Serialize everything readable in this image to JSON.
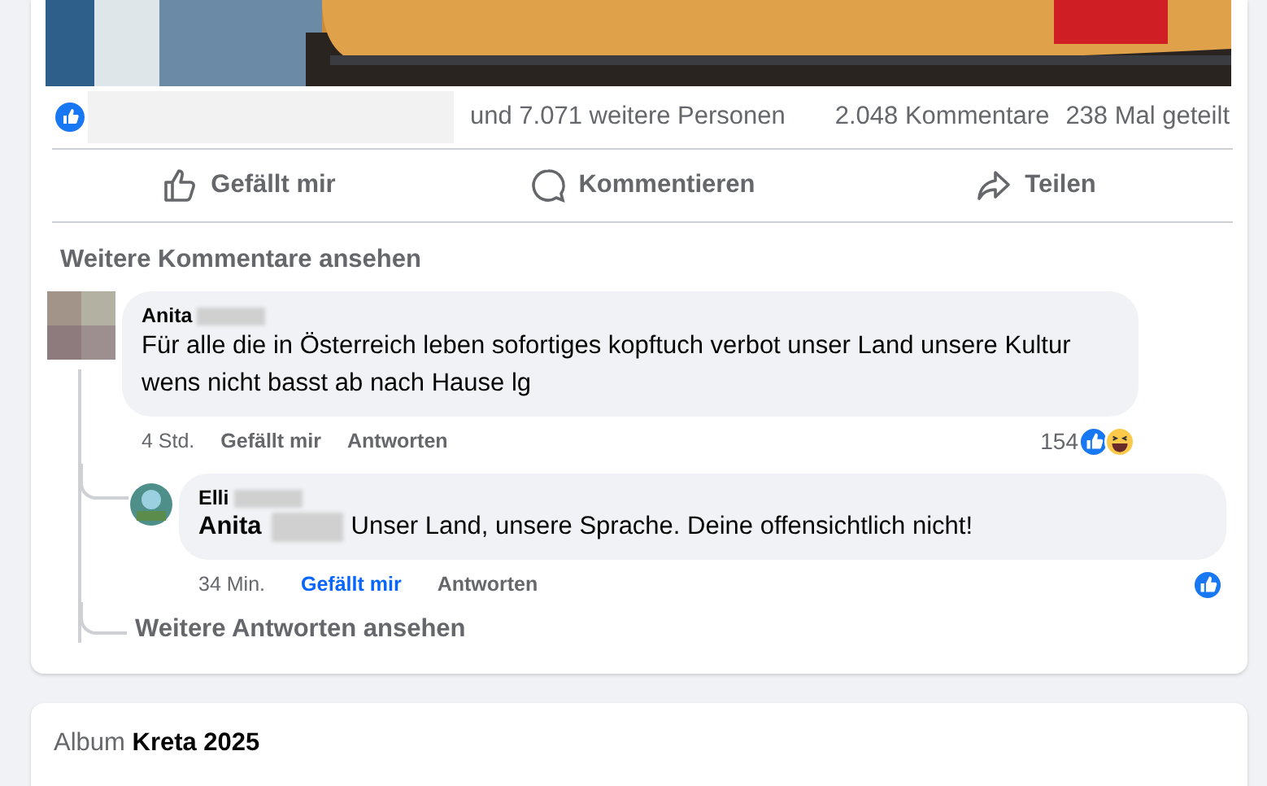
{
  "post": {
    "reactions_summary": "und 7.071 weitere Personen",
    "comments_count": "2.048 Kommentare",
    "shares_count": "238 Mal geteilt",
    "actions": [
      {
        "kind": "like",
        "label": "Gefällt mir"
      },
      {
        "kind": "comment",
        "label": "Kommentieren"
      },
      {
        "kind": "share",
        "label": "Teilen"
      }
    ],
    "more_comments": "Weitere Kommentare ansehen",
    "comment": {
      "author": "Anita",
      "text": "Für alle die in Österreich leben sofortiges kopftuch verbot unser Land unsere Kultur wens nicht basst ab nach Hause lg",
      "time": "4 Std.",
      "like_label": "Gefällt mir",
      "reply_label": "Antworten",
      "liked": false,
      "reaction_count": "154",
      "reactions": [
        {
          "kind": "like"
        },
        {
          "kind": "haha"
        }
      ],
      "replies": [
        {
          "author": "Elli",
          "mention": "Anita",
          "text": "Unser Land, unsere Sprache. Deine offensichtlich nicht!",
          "time": "34 Min.",
          "like_label": "Gefällt mir",
          "reply_label": "Antworten",
          "liked": true,
          "reactions": [
            {
              "kind": "like"
            }
          ]
        }
      ]
    },
    "more_replies": "Weitere Antworten ansehen"
  },
  "album": {
    "label": "Album",
    "name": "Kreta 2025"
  }
}
